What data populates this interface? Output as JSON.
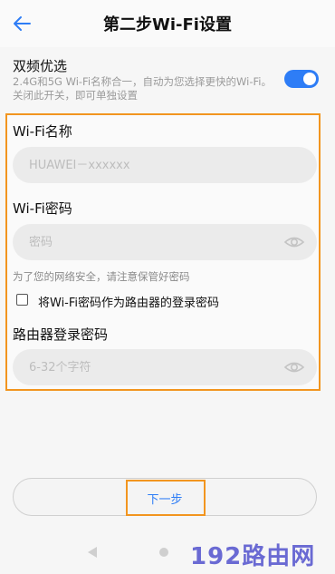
{
  "header": {
    "title": "第二步Wi-Fi设置",
    "back_icon": "arrow-left-icon"
  },
  "dual_band": {
    "title": "双频优选",
    "description": "2.4G和5G Wi-Fi名称合一，自动为您选择更快的Wi-Fi。关闭此开关，即可单独设置",
    "enabled": true
  },
  "wifi_name": {
    "label": "Wi-Fi名称",
    "placeholder": "HUAWEI－xxxxxx",
    "value": ""
  },
  "wifi_password": {
    "label": "Wi-Fi密码",
    "placeholder": "密码",
    "value": "",
    "eye_icon": "eye-icon"
  },
  "security_hint": "为了您的网络安全，请注意保管好密码",
  "use_as_router_password": {
    "label": "将Wi-Fi密码作为路由器的登录密码",
    "checked": false
  },
  "router_password": {
    "label": "路由器登录密码",
    "placeholder": "6-32个字符",
    "value": "",
    "eye_icon": "eye-icon"
  },
  "next_button": {
    "label": "下一步"
  },
  "navigation": {
    "back_icon": "triangle-back-icon",
    "home_icon": "circle-home-icon"
  },
  "watermark": "192路由网",
  "colors": {
    "accent": "#2e7df6",
    "highlight": "#f2951f",
    "watermark": "#5b5bd0"
  }
}
